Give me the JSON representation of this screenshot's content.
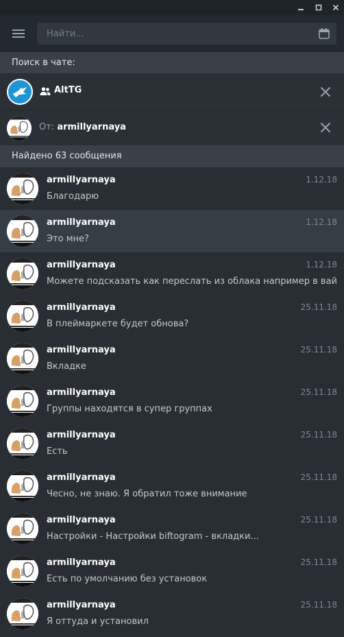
{
  "window": {
    "controls": [
      "minimize",
      "maximize",
      "close"
    ]
  },
  "search": {
    "placeholder": "Найти..."
  },
  "chat_search": {
    "header": "Поиск в чате:",
    "chat": {
      "name": "AltTG",
      "type_icon": "group-icon"
    },
    "from": {
      "prefix": "От:",
      "user": "armillyarnaya"
    }
  },
  "results": {
    "header": "Найдено 63 сообщения",
    "items": [
      {
        "name": "armillyarnaya",
        "date": "1.12.18",
        "text": "Благодарю",
        "active": false
      },
      {
        "name": "armillyarnaya",
        "date": "1.12.18",
        "text": "Это мне?",
        "active": true
      },
      {
        "name": "armillyarnaya",
        "date": "1.12.18",
        "text": "Можете подсказать как переслать из облака например в вайбер? ...",
        "active": false
      },
      {
        "name": "armillyarnaya",
        "date": "25.11.18",
        "text": "В плеймаркете будет обнова?",
        "active": false
      },
      {
        "name": "armillyarnaya",
        "date": "25.11.18",
        "text": "Вкладке",
        "active": false
      },
      {
        "name": "armillyarnaya",
        "date": "25.11.18",
        "text": "Группы находятся в супер группах",
        "active": false
      },
      {
        "name": "armillyarnaya",
        "date": "25.11.18",
        "text": "Есть",
        "active": false
      },
      {
        "name": "armillyarnaya",
        "date": "25.11.18",
        "text": "Чесно, не знаю. Я обратил тоже внимание",
        "active": false
      },
      {
        "name": "armillyarnaya",
        "date": "25.11.18",
        "text": "Настройки - Настройки biftogram - вкладки...",
        "active": false
      },
      {
        "name": "armillyarnaya",
        "date": "25.11.18",
        "text": "Есть по умолчанию без установок",
        "active": false
      },
      {
        "name": "armillyarnaya",
        "date": "25.11.18",
        "text": "Я оттуда и установил",
        "active": false
      }
    ]
  },
  "colors": {
    "background": "#282e33",
    "header": "#3a4047",
    "active_row": "#353d45",
    "accent_avatar": "#1e96d3"
  }
}
